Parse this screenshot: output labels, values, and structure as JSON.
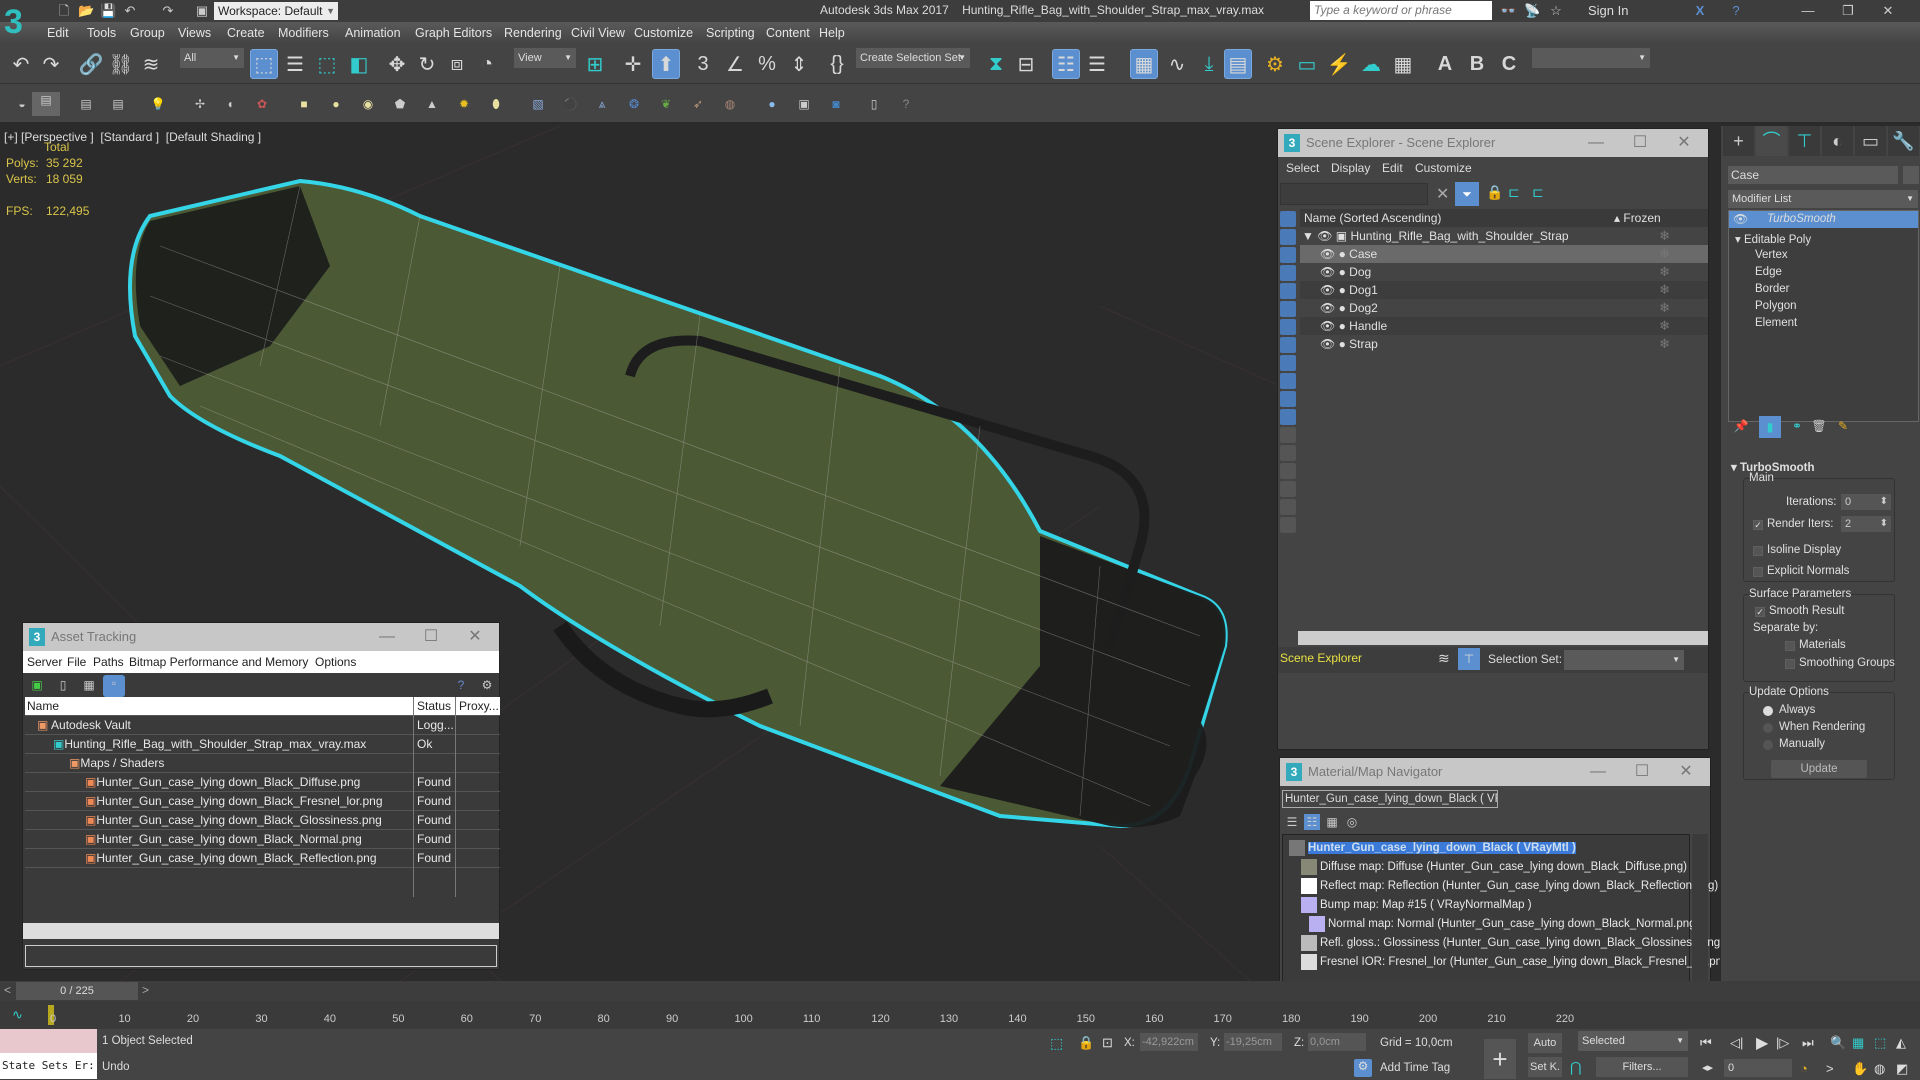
{
  "app": {
    "title": "Autodesk 3ds Max 2017",
    "file": "Hunting_Rifle_Bag_with_Shoulder_Strap_max_vray.max",
    "workspace": "Workspace: Default",
    "search_placeholder": "Type a keyword or phrase",
    "sign_in": "Sign In"
  },
  "menu": [
    "Edit",
    "Tools",
    "Group",
    "Views",
    "Create",
    "Modifiers",
    "Animation",
    "Graph Editors",
    "Rendering",
    "Civil View",
    "Customize",
    "Scripting",
    "Content",
    "Help"
  ],
  "toolbar": {
    "selection_filter": "All",
    "ref_coord": "View",
    "named_selection": "Create Selection Set"
  },
  "viewport": {
    "label": "[+] [Perspective ]  [Standard ]  [Default Shading ]",
    "stats_header": "Total",
    "polys_label": "Polys:",
    "polys": "35 292",
    "verts_label": "Verts:",
    "verts": "18 059",
    "fps_label": "FPS:",
    "fps": "122,495"
  },
  "scene_explorer": {
    "title": "Scene Explorer - Scene Explorer",
    "menu": [
      "Select",
      "Display",
      "Edit",
      "Customize"
    ],
    "col_name": "Name (Sorted Ascending)",
    "col_frozen": "Frozen",
    "root": "Hunting_Rifle_Bag_with_Shoulder_Strap",
    "items": [
      "Case",
      "Dog",
      "Dog1",
      "Dog2",
      "Handle",
      "Strap"
    ],
    "selected": "Case",
    "footer_label": "Scene Explorer",
    "selection_set_label": "Selection Set:"
  },
  "material_navigator": {
    "title": "Material/Map Navigator",
    "current": "Hunter_Gun_case_lying_down_Black  ( VRayM",
    "root": "Hunter_Gun_case_lying_down_Black  ( VRayMtl )",
    "maps": [
      "Diffuse map: Diffuse (Hunter_Gun_case_lying down_Black_Diffuse.png)",
      "Reflect map: Reflection (Hunter_Gun_case_lying down_Black_Reflection.png)",
      "Bump map: Map #15  ( VRayNormalMap )",
      "Normal map: Normal (Hunter_Gun_case_lying down_Black_Normal.png)",
      "Refl. gloss.: Glossiness (Hunter_Gun_case_lying down_Black_Glossiness.png)",
      "Fresnel IOR: Fresnel_Ior (Hunter_Gun_case_lying down_Black_Fresnel_Ior.png"
    ]
  },
  "asset_tracking": {
    "title": "Asset Tracking",
    "menu": [
      "Server",
      "File",
      "Paths",
      "Bitmap Performance and Memory",
      "Options"
    ],
    "columns": [
      "Name",
      "Status",
      "Proxy..."
    ],
    "rows": [
      {
        "name": "Autodesk Vault",
        "status": "Logg...",
        "indent": 0
      },
      {
        "name": "Hunting_Rifle_Bag_with_Shoulder_Strap_max_vray.max",
        "status": "Ok",
        "indent": 1
      },
      {
        "name": "Maps / Shaders",
        "status": "",
        "indent": 2
      },
      {
        "name": "Hunter_Gun_case_lying down_Black_Diffuse.png",
        "status": "Found",
        "indent": 3
      },
      {
        "name": "Hunter_Gun_case_lying down_Black_Fresnel_lor.png",
        "status": "Found",
        "indent": 3
      },
      {
        "name": "Hunter_Gun_case_lying down_Black_Glossiness.png",
        "status": "Found",
        "indent": 3
      },
      {
        "name": "Hunter_Gun_case_lying down_Black_Normal.png",
        "status": "Found",
        "indent": 3
      },
      {
        "name": "Hunter_Gun_case_lying down_Black_Reflection.png",
        "status": "Found",
        "indent": 3
      }
    ]
  },
  "command_panel": {
    "object_name": "Case",
    "modifier_list": "Modifier List",
    "stack": [
      "TurboSmooth",
      "Editable Poly"
    ],
    "subobjects": [
      "Vertex",
      "Edge",
      "Border",
      "Polygon",
      "Element"
    ],
    "rollout": "TurboSmooth",
    "main": "Main",
    "iterations_label": "Iterations:",
    "iterations": "0",
    "render_iters_label": "Render Iters:",
    "render_iters": "2",
    "render_iters_checked": true,
    "isoline": "Isoline Display",
    "explicit_normals": "Explicit Normals",
    "surface_params": "Surface Parameters",
    "smooth_result": "Smooth Result",
    "separate_by": "Separate by:",
    "materials": "Materials",
    "smoothing_groups": "Smoothing Groups",
    "update_options": "Update Options",
    "always": "Always",
    "when_rendering": "When Rendering",
    "manually": "Manually",
    "update_button": "Update"
  },
  "timeline": {
    "frame": "0 / 225",
    "ticks": [
      "0",
      "10",
      "20",
      "30",
      "40",
      "50",
      "60",
      "70",
      "80",
      "90",
      "100",
      "110",
      "120",
      "130",
      "140",
      "150",
      "160",
      "170",
      "180",
      "190",
      "200",
      "210",
      "220"
    ]
  },
  "status": {
    "script_listener": "State Sets Er:",
    "selected": "1 Object Selected",
    "prompt": "Undo",
    "x_label": "X:",
    "x": "-42,922cm",
    "y_label": "Y:",
    "y": "-19,25cm",
    "z_label": "Z:",
    "z": "0,0cm",
    "grid": "Grid = 10,0cm",
    "add_time_tag": "Add Time Tag",
    "auto": "Auto",
    "set_key": "Set K.",
    "key_filter": "Selected",
    "filters": "Filters...",
    "current_frame": "0"
  },
  "colors": {
    "accent": "#5b8fcf",
    "selection_outline": "#35d5e8",
    "stats_yellow": "#d8c44a"
  }
}
